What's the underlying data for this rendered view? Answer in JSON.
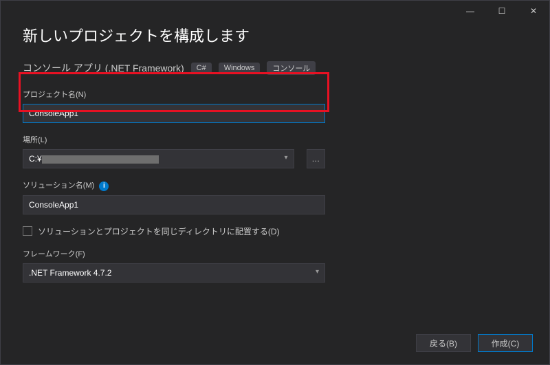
{
  "titlebar": {
    "minimize": "—",
    "maximize": "☐",
    "close": "✕"
  },
  "heading": "新しいプロジェクトを構成します",
  "subtitle": "コンソール アプリ (.NET Framework)",
  "tags": [
    "C#",
    "Windows",
    "コンソール"
  ],
  "labels": {
    "project_name": "プロジェクト名(N)",
    "location": "場所(L)",
    "solution_name": "ソリューション名(M)",
    "same_dir": "ソリューションとプロジェクトを同じディレクトリに配置する(D)",
    "framework": "フレームワーク(F)"
  },
  "values": {
    "project_name": "ConsoleApp1",
    "location_prefix": "C:¥",
    "solution_name": "ConsoleApp1",
    "framework": ".NET Framework 4.7.2"
  },
  "browse_btn": "…",
  "info_icon": "i",
  "buttons": {
    "back": "戻る(B)",
    "create": "作成(C)"
  }
}
